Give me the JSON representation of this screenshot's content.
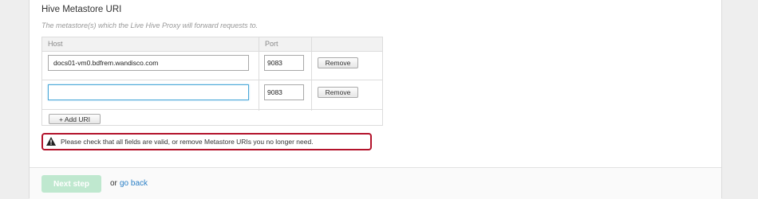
{
  "section": {
    "title": "Hive Metastore URI",
    "description": "The metastore(s) which the Live Hive Proxy will forward requests to."
  },
  "table": {
    "headers": {
      "host": "Host",
      "port": "Port"
    },
    "rows": [
      {
        "host": "docs01-vm0.bdfrem.wandisco.com",
        "port": "9083",
        "remove_label": "Remove"
      },
      {
        "host": "",
        "port": "9083",
        "remove_label": "Remove"
      }
    ],
    "add_label": "+ Add URI"
  },
  "alert": {
    "message": "Please check that all fields are valid, or remove Metastore URIs you no longer need.",
    "border_color": "#b3132b",
    "icon": "warning-icon"
  },
  "footer": {
    "next_label": "Next step",
    "or_text": "or",
    "back_label": "go back",
    "link_color": "#2a7fc6",
    "next_color": "#bfe8cf"
  }
}
